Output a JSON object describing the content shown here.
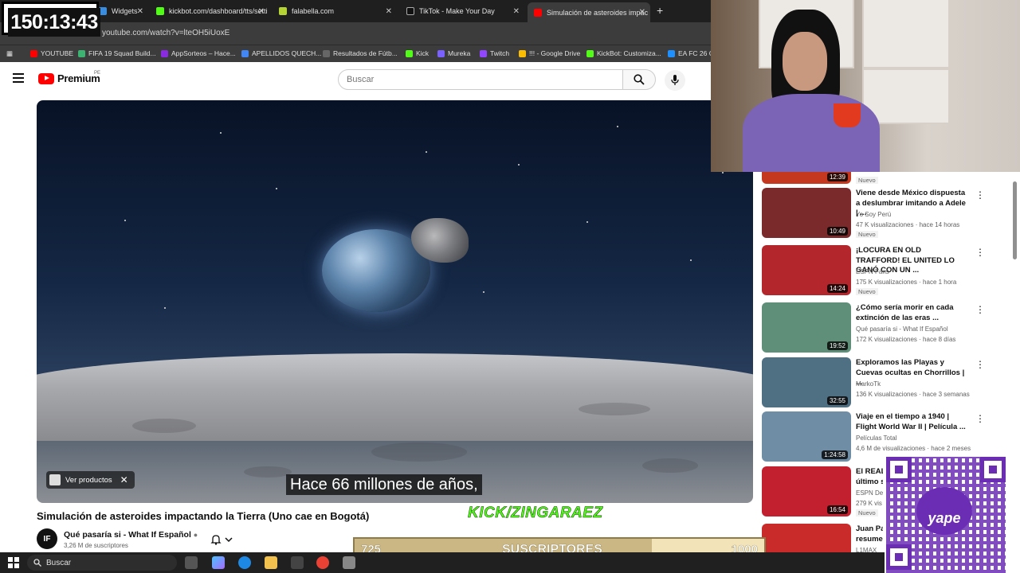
{
  "overlay": {
    "timer": "150:13:43",
    "kick_tag": "KICK/ZINGARAEZ",
    "subs_current": "725",
    "subs_label": "SUSCRIPTORES",
    "subs_goal": "1000",
    "subs_progress": 0.725,
    "qr_brand": "yape"
  },
  "browser": {
    "tabs": [
      {
        "label": "Widgets",
        "color": "#3a8dde"
      },
      {
        "label": "kickbot.com/dashboard/tts/setti",
        "color": "#53fc18"
      },
      {
        "label": "falabella.com",
        "color": "#b5d334"
      },
      {
        "label": "TikTok - Make Your Day",
        "color": "#111111"
      },
      {
        "label": "Simulación de asteroides impac",
        "color": "#ff0000"
      }
    ],
    "url": "youtube.com/watch?v=lteOH5iUoxE",
    "bookmarks": [
      {
        "label": "YOUTUBE",
        "color": "#ff0000"
      },
      {
        "label": "FIFA 19 Squad Build...",
        "color": "#3cb371"
      },
      {
        "label": "AppSorteos – Hace...",
        "color": "#8a2be2"
      },
      {
        "label": "APELLIDOS QUECH...",
        "color": "#4285f4"
      },
      {
        "label": "Resultados de Fútb...",
        "color": "#666666"
      },
      {
        "label": "Kick",
        "color": "#53fc18"
      },
      {
        "label": "Mureka",
        "color": "#7b61ff"
      },
      {
        "label": "Twitch",
        "color": "#9146ff"
      },
      {
        "label": "!!! - Google Drive",
        "color": "#fbbc04"
      },
      {
        "label": "KickBot: Customiza...",
        "color": "#53fc18"
      },
      {
        "label": "EA FC 26 C...",
        "color": "#1e90ff"
      }
    ]
  },
  "youtube": {
    "logo_text": "Premium",
    "region": "PE",
    "search_placeholder": "Buscar",
    "video": {
      "caption": "Hace 66 millones de años,",
      "products_label": "Ver productos",
      "title": "Simulación de asteroides impactando la Tierra (Uno cae en Bogotá)",
      "channel": "Qué pasaría si - What If Español",
      "channel_initials": "IF",
      "subscribers": "3,26 M de suscriptores"
    },
    "recommendations": [
      {
        "title": "Viene desde México dispuesta a deslumbrar imitando a Adele | ...",
        "channel": "Yo Soy Perú",
        "meta": "47 K visualizaciones · hace 14 horas",
        "badge": "Nuevo",
        "duration": "10:49",
        "thumb": "#7a2a2a"
      },
      {
        "title": "¡LOCURA EN OLD TRAFFORD! EL UNITED LO GANÓ CON UN ...",
        "channel": "ESPN Fans",
        "meta": "175 K visualizaciones · hace 1 hora",
        "badge": "Nuevo",
        "duration": "14:24",
        "thumb": "#b3262b"
      },
      {
        "title": "¿Cómo sería morir en cada extinción de las eras ...",
        "channel": "Qué pasaría si - What If Español",
        "meta": "172 K visualizaciones · hace 8 días",
        "badge": "",
        "duration": "19:52",
        "thumb": "#5f8f79"
      },
      {
        "title": "Exploramos las Playas y Cuevas ocultas en Chorrillos | ...",
        "channel": "MarkoTk",
        "meta": "136 K visualizaciones · hace 3 semanas",
        "badge": "",
        "duration": "32:55",
        "thumb": "#4f6f83"
      },
      {
        "title": "Viaje en el tiempo a 1940 | Flight World War II | Película ...",
        "channel": "Películas Total",
        "meta": "4,6 M de visualizaciones · hace 2 meses",
        "badge": "",
        "duration": "1:24:58",
        "thumb": "#6f8ea6"
      },
      {
        "title": "El REAL último s",
        "channel": "ESPN De",
        "meta": "279 K vis",
        "badge": "Nuevo",
        "duration": "16:54",
        "thumb": "#c21f2f"
      },
      {
        "title": "Juan Pa resume",
        "channel": "L1MAX",
        "meta": "",
        "badge": "",
        "duration": "",
        "thumb": "#c92a2a"
      }
    ],
    "top_partial_badge": "Nuevo",
    "top_partial_duration": "12:39"
  },
  "taskbar": {
    "search_label": "Buscar"
  }
}
